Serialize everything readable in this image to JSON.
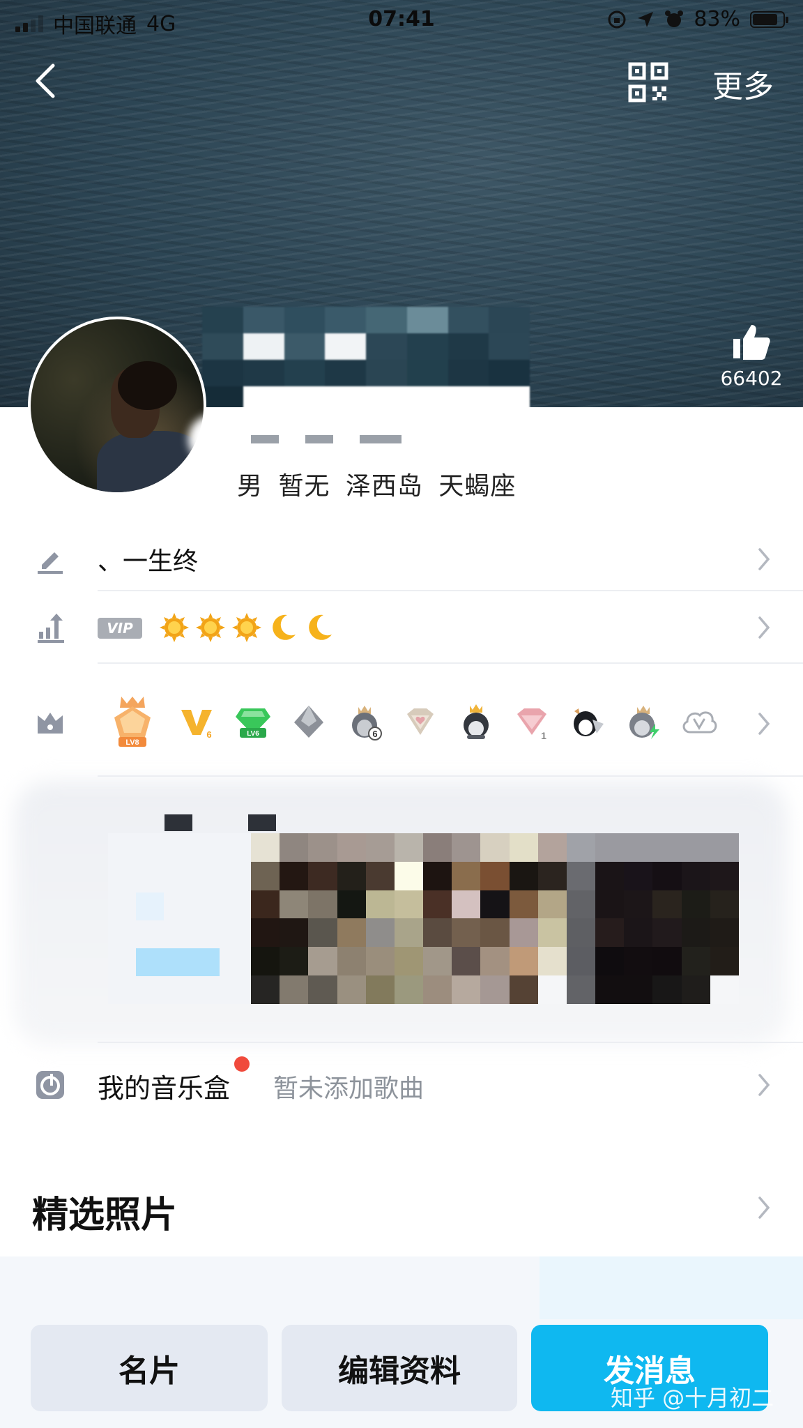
{
  "status_bar": {
    "carrier": "中国联通",
    "network": "4G",
    "time": "07:41",
    "battery": "83%",
    "battery_level": 0.83
  },
  "nav": {
    "back_icon": "chevron-left-icon",
    "qr_icon": "qr-code-icon",
    "more_label": "更多"
  },
  "likes": {
    "icon": "thumbs-up-icon",
    "count": "66402"
  },
  "profile": {
    "basic_info": "男 暂无 泽西岛 天蝎座"
  },
  "rows": {
    "signature": {
      "icon": "pencil-icon",
      "text": "、一生终"
    },
    "level": {
      "icon": "level-up-icon",
      "vip_badge": "VIP",
      "level_icons": [
        "sun",
        "sun",
        "sun",
        "moon",
        "moon"
      ]
    },
    "badges": {
      "icon": "crown-icon",
      "items": [
        {
          "name": "lv8-medal-badge",
          "label": "LV8"
        },
        {
          "name": "vip-v-badge",
          "label": "6"
        },
        {
          "name": "green-diamond-badge",
          "label": "LV6"
        },
        {
          "name": "silver-gem-badge",
          "label": ""
        },
        {
          "name": "penguin-crown-badge",
          "label": "6"
        },
        {
          "name": "pink-diamond-badge",
          "label": ""
        },
        {
          "name": "penguin-king-badge",
          "label": ""
        },
        {
          "name": "pink-gem-badge",
          "label": "1"
        },
        {
          "name": "penguin-wing-badge",
          "label": ""
        },
        {
          "name": "penguin-lightning-badge",
          "label": ""
        },
        {
          "name": "cloud-v-badge",
          "label": ""
        }
      ]
    },
    "music": {
      "icon": "music-box-icon",
      "title": "我的音乐盒",
      "status": "暂未添加歌曲"
    }
  },
  "sections": {
    "photos_title": "精选照片"
  },
  "actions": {
    "card": "名片",
    "edit": "编辑资料",
    "message": "发消息"
  },
  "watermark": "知乎 @十月初二",
  "colors": {
    "accent": "#0fb8f0",
    "secondary_button": "#e4e9f2",
    "notification_dot": "#f04a3c",
    "muted_text": "#8d939b",
    "icon_gray": "#8f95a3"
  }
}
